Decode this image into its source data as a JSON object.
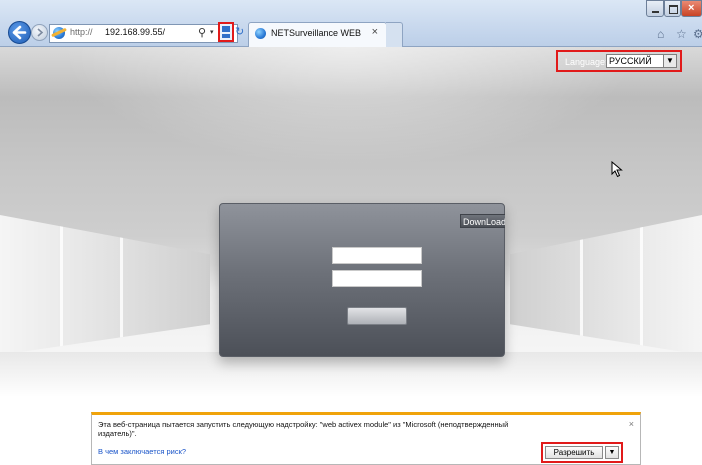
{
  "browser": {
    "url_protocol": "http://",
    "url_host": "192.168.99.55/",
    "search_glyph": "⚲",
    "dropdown_glyph": "▾",
    "refresh_glyph": "↻",
    "tab_title": "NETSurveillance WEB",
    "tab_close": "×",
    "close_glyph": "×",
    "home_glyph": "⌂",
    "star_glyph": "☆",
    "gear_glyph": "⚙"
  },
  "header": {
    "language_label": "Language:",
    "language_value": "РУССКИЙ",
    "language_arrow": "▼"
  },
  "login": {
    "download_label": "DownLoad"
  },
  "notification": {
    "message": "Эта веб-страница пытается запустить следующую надстройку: \"web activex module\" из \"Microsoft (неподтвержденный издатель)\".",
    "link": "В чем заключается риск?",
    "allow_label": "Разрешить",
    "dropdown_arrow": "▼",
    "close": "×"
  },
  "colors": {
    "highlight": "#e11a1a",
    "notify_accent": "#f0a30a",
    "link": "#1a55c9"
  }
}
